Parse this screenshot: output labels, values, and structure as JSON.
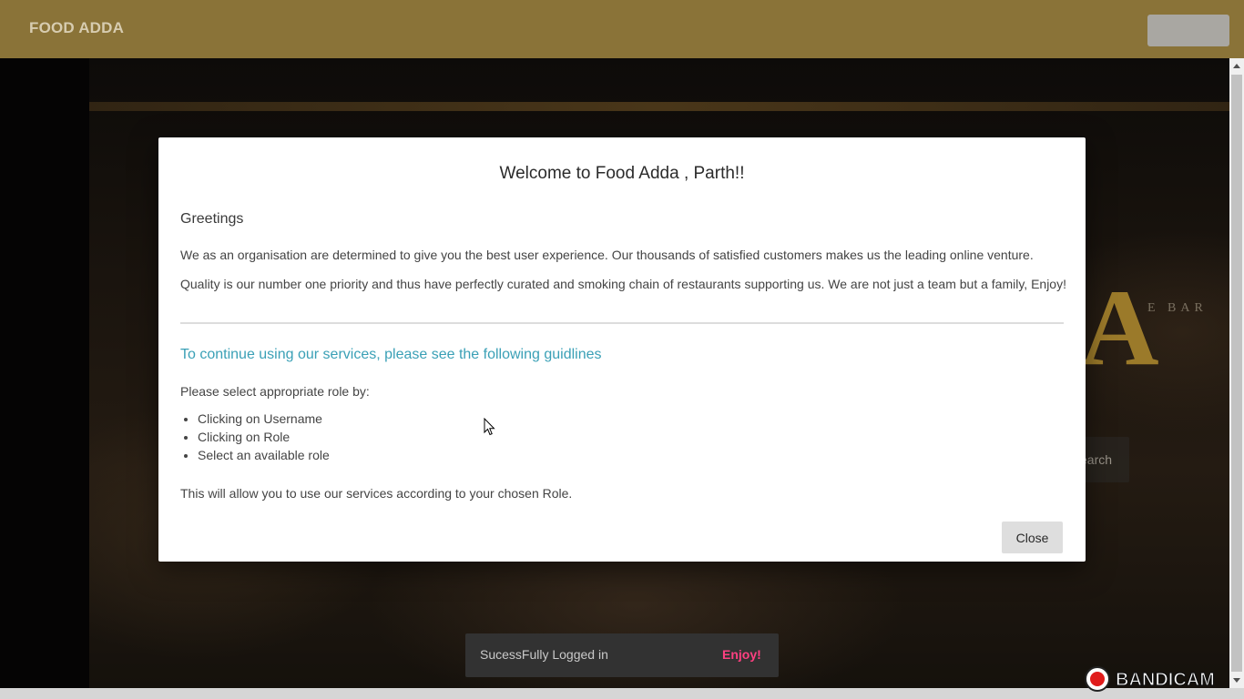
{
  "header": {
    "brand": "FOOD ADDA"
  },
  "background": {
    "sign_letter": "A",
    "bar_sign": "E BAR",
    "search_label": "earch"
  },
  "modal": {
    "title": "Welcome to Food Adda , Parth!!",
    "greeting": "Greetings",
    "paragraph1": "We as an organisation are determined to give you the best user experience. Our thousands of satisfied customers makes us the leading online venture.",
    "paragraph2": "Quality is our number one priority and thus have perfectly curated and smoking chain of restaurants supporting us. We are not just a team but a family, Enjoy!",
    "guideline_heading": "To continue using our services, please see the following guidlines",
    "role_instruction": "Please select appropriate role by:",
    "steps": [
      "Clicking on Username",
      "Clicking on Role",
      "Select an available role"
    ],
    "closing_text": "This will allow you to use our services according to your chosen Role.",
    "close_label": "Close"
  },
  "snackbar": {
    "message": "SucessFully Logged in",
    "action": "Enjoy!"
  },
  "watermark": {
    "text": "BANDICAM",
    "icon": "record-icon"
  },
  "colors": {
    "appbar": "#8a7338",
    "guideline": "#3aa0b6",
    "snackbar_action": "#ff4081"
  }
}
